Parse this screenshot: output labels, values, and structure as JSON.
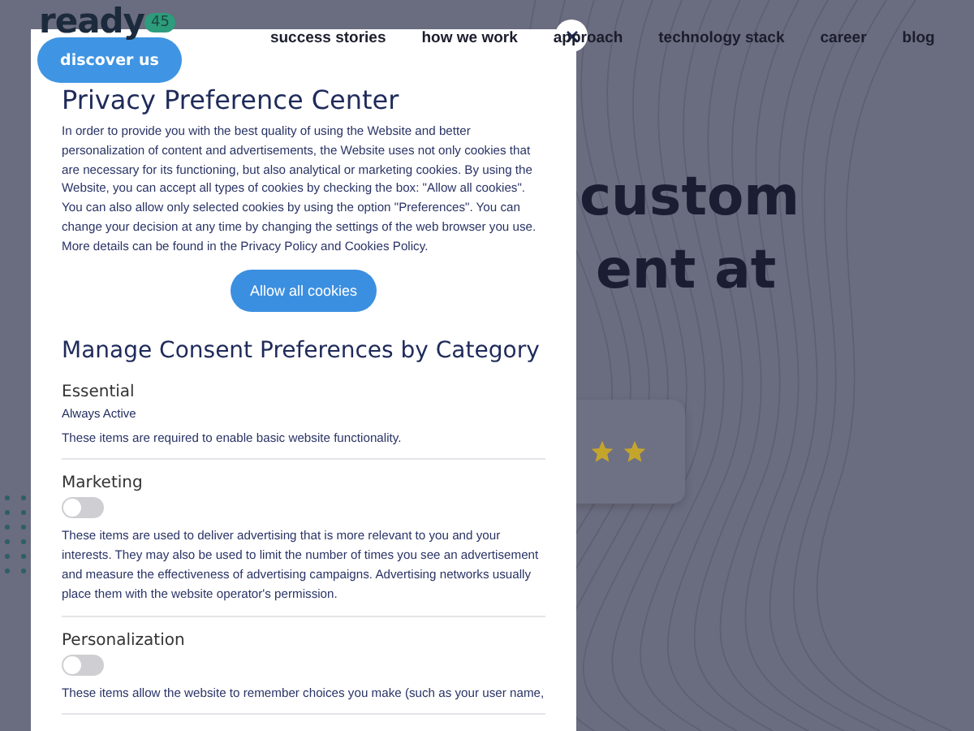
{
  "header": {
    "logo": {
      "text": "ready",
      "badge": "45"
    },
    "nav": [
      "success stories",
      "how we work",
      "approach",
      "technology stack",
      "career",
      "blog"
    ],
    "cta": "discover us"
  },
  "hero": {
    "lines": [
      "custom",
      "ent at"
    ]
  },
  "dialog": {
    "title": "Privacy Preference Center",
    "intro": "In order to provide you with the best quality of using the Website and better personalization of content and advertisements, the Website uses not only cookies that are necessary for its functioning, but also analytical or marketing cookies. By using the Website, you can accept all types of cookies by checking the box: \"Allow all cookies\". You can also allow only selected cookies by using the option \"Preferences\". You can change your decision at any time by changing the settings of the web browser you use. More details can be found in the Privacy Policy and Cookies Policy.",
    "allow_button": "Allow all cookies",
    "section_title": "Manage Consent Preferences by Category",
    "categories": [
      {
        "kind": "fixed",
        "name": "Essential",
        "status": "Always Active",
        "description": "These items are required to enable basic website functionality."
      },
      {
        "kind": "toggle",
        "name": "Marketing",
        "on": false,
        "description": "These items are used to deliver advertising that is more relevant to you and your interests. They may also be used to limit the number of times you see an advertisement and measure the effectiveness of advertising campaigns. Advertising networks usually place them with the website operator's permission."
      },
      {
        "kind": "toggle",
        "name": "Personalization",
        "on": false,
        "description": "These items allow the website to remember choices you make (such as your user name,"
      }
    ]
  }
}
